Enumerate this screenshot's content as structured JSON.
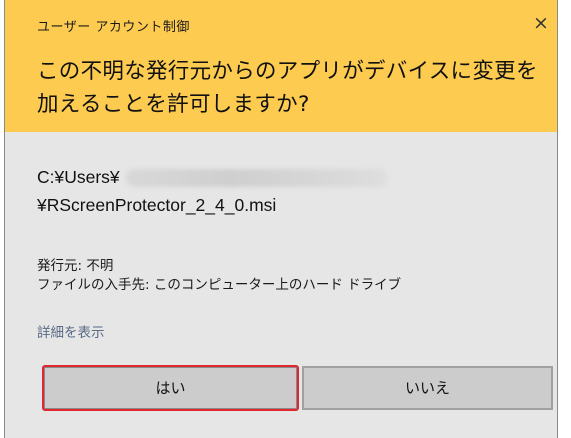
{
  "dialog": {
    "title": "ユーザー アカウント制御",
    "close_glyph": "×",
    "question_line1": "この不明な発行元からのアプリがデバイスに変更を",
    "question_line2": "加えることを許可しますか?",
    "file_path_prefix": "C:¥Users¥",
    "file_name": "¥RScreenProtector_2_4_0.msi",
    "publisher_line": "発行元: 不明",
    "origin_line": "ファイルの入手先: このコンピューター上のハード ドライブ",
    "details_link": "詳細を表示",
    "yes_button": "はい",
    "no_button": "いいえ"
  },
  "colors": {
    "header_bg": "#fdcb50",
    "body_bg": "#e6e6e6",
    "highlight_border": "#e0262e",
    "link": "#5a6b85"
  },
  "icons": {
    "close": "close-icon"
  }
}
